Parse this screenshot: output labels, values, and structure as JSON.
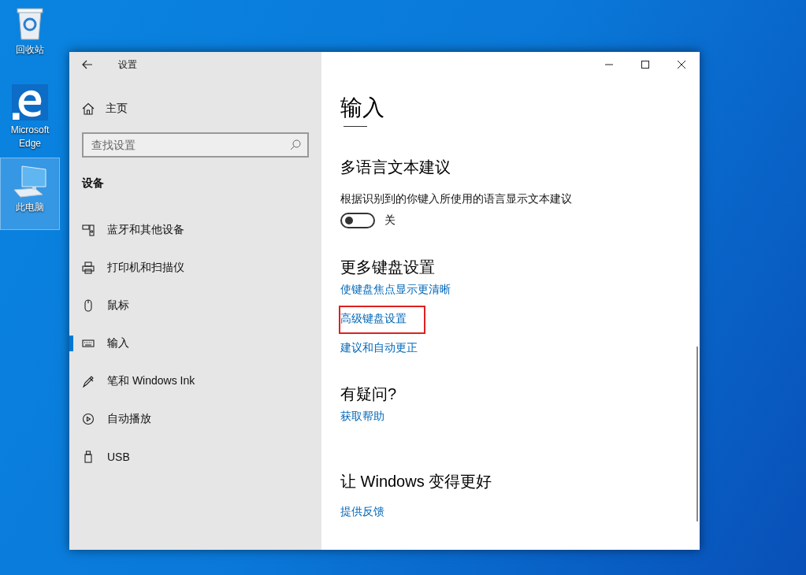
{
  "desktop_icons": [
    {
      "label": "回收站",
      "kind": "recycle-bin",
      "selected": false
    },
    {
      "label": "Microsoft Edge",
      "kind": "edge",
      "selected": false
    },
    {
      "label": "此电脑",
      "kind": "computer",
      "selected": true
    }
  ],
  "window": {
    "title": "设置"
  },
  "sidebar": {
    "home": "主页",
    "search": {
      "placeholder": "查找设置"
    },
    "section": "设备",
    "items": [
      {
        "label": "蓝牙和其他设备",
        "selected": false
      },
      {
        "label": "打印机和扫描仪",
        "selected": false
      },
      {
        "label": "鼠标",
        "selected": false
      },
      {
        "label": "输入",
        "selected": true
      },
      {
        "label": "笔和 Windows Ink",
        "selected": false
      },
      {
        "label": "自动播放",
        "selected": false
      },
      {
        "label": "USB",
        "selected": false
      }
    ]
  },
  "content": {
    "title": "输入",
    "sections": [
      {
        "heading": "多语言文本建议",
        "description": "根据识别到的你键入所使用的语言显示文本建议",
        "toggle": {
          "on": false,
          "label": "关"
        }
      },
      {
        "heading": "更多键盘设置",
        "links": [
          {
            "text": "使键盘焦点显示更清晰",
            "highlighted": false
          },
          {
            "text": "高级键盘设置",
            "highlighted": true
          },
          {
            "text": "建议和自动更正",
            "highlighted": false
          }
        ]
      },
      {
        "heading": "有疑问?",
        "links": [
          {
            "text": "获取帮助",
            "highlighted": false
          }
        ]
      },
      {
        "heading": "让 Windows 变得更好",
        "links": [
          {
            "text": "提供反馈",
            "highlighted": false
          }
        ]
      }
    ]
  }
}
